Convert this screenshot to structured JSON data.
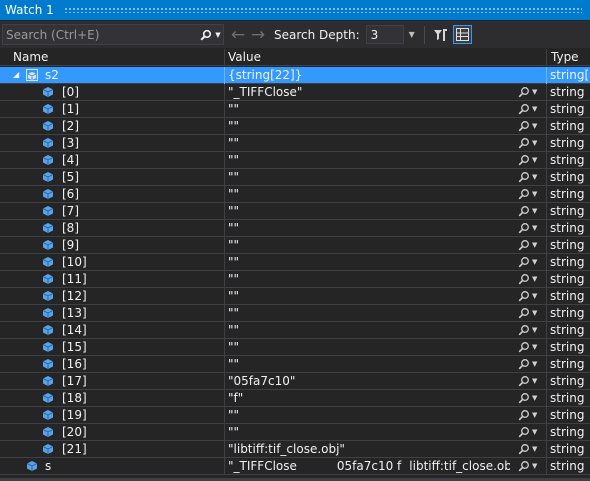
{
  "window": {
    "title": "Watch 1"
  },
  "toolbar": {
    "search_placeholder": "Search (Ctrl+E)",
    "search_depth_label": "Search Depth:",
    "search_depth_value": "3"
  },
  "columns": {
    "name": "Name",
    "value": "Value",
    "type": "Type"
  },
  "colors": {
    "accent": "#007acc",
    "selection": "#3399ff",
    "background": "#252526",
    "cube": "#5aa3e6"
  },
  "root": {
    "name": "s2",
    "value": "{string[22]}",
    "type": "string[]"
  },
  "elements": [
    {
      "name": "[0]",
      "value": "\"_TIFFClose\"",
      "type": "string"
    },
    {
      "name": "[1]",
      "value": "\"\"",
      "type": "string"
    },
    {
      "name": "[2]",
      "value": "\"\"",
      "type": "string"
    },
    {
      "name": "[3]",
      "value": "\"\"",
      "type": "string"
    },
    {
      "name": "[4]",
      "value": "\"\"",
      "type": "string"
    },
    {
      "name": "[5]",
      "value": "\"\"",
      "type": "string"
    },
    {
      "name": "[6]",
      "value": "\"\"",
      "type": "string"
    },
    {
      "name": "[7]",
      "value": "\"\"",
      "type": "string"
    },
    {
      "name": "[8]",
      "value": "\"\"",
      "type": "string"
    },
    {
      "name": "[9]",
      "value": "\"\"",
      "type": "string"
    },
    {
      "name": "[10]",
      "value": "\"\"",
      "type": "string"
    },
    {
      "name": "[11]",
      "value": "\"\"",
      "type": "string"
    },
    {
      "name": "[12]",
      "value": "\"\"",
      "type": "string"
    },
    {
      "name": "[13]",
      "value": "\"\"",
      "type": "string"
    },
    {
      "name": "[14]",
      "value": "\"\"",
      "type": "string"
    },
    {
      "name": "[15]",
      "value": "\"\"",
      "type": "string"
    },
    {
      "name": "[16]",
      "value": "\"\"",
      "type": "string"
    },
    {
      "name": "[17]",
      "value": "\"05fa7c10\"",
      "type": "string"
    },
    {
      "name": "[18]",
      "value": "\"f\"",
      "type": "string"
    },
    {
      "name": "[19]",
      "value": "\"\"",
      "type": "string"
    },
    {
      "name": "[20]",
      "value": "\"\"",
      "type": "string"
    },
    {
      "name": "[21]",
      "value": "\"libtiff:tif_close.obj\"",
      "type": "string"
    }
  ],
  "s_row": {
    "name": "s",
    "value_parts": [
      "\"_TIFFClose",
      "05fa7c10 f",
      "libtiff:tif_close.obj\""
    ],
    "type": "string"
  },
  "icons": {
    "search": "magnifier-icon",
    "back": "arrow-left-icon",
    "forward": "arrow-right-icon",
    "filter": "filter-pin-icon",
    "columns": "columns-toggle-icon",
    "variable": "cube-icon"
  }
}
